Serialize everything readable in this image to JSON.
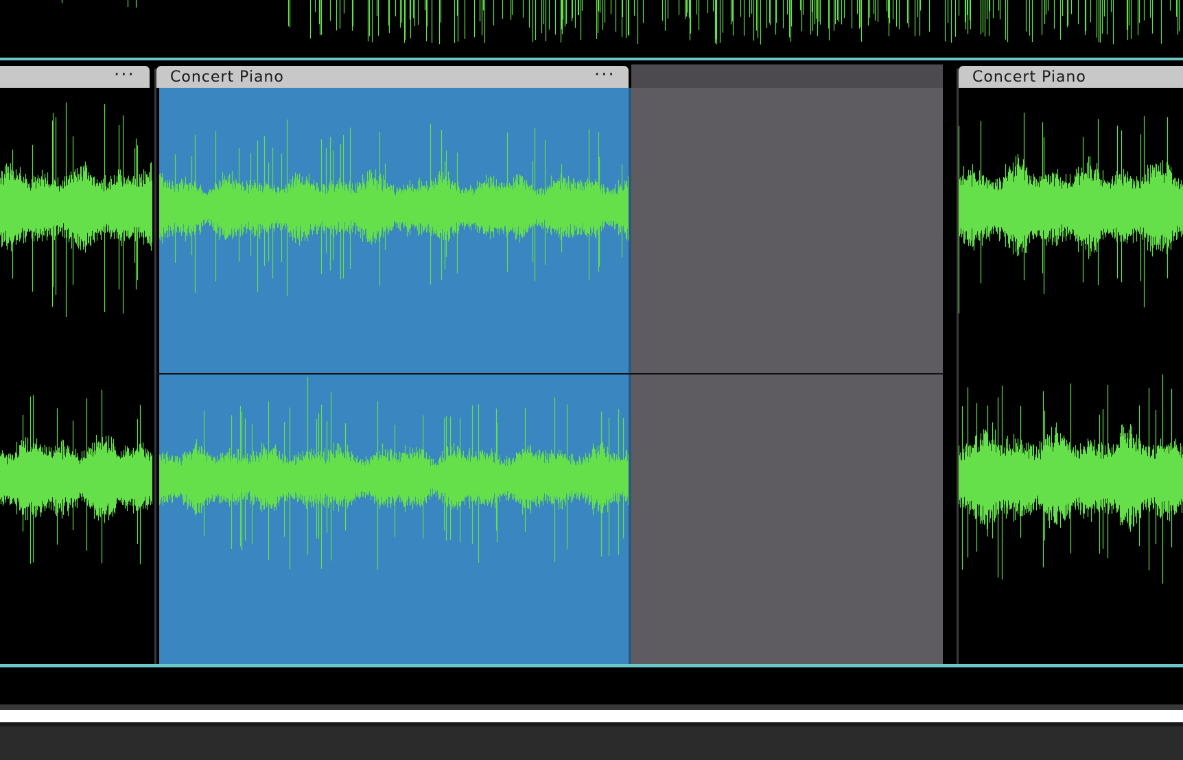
{
  "track": {
    "clips": [
      {
        "id": "clip-left",
        "name": "",
        "menu": "···"
      },
      {
        "id": "clip-selected",
        "name": "Concert  Piano",
        "menu": "···",
        "selected": true
      },
      {
        "id": "clip-right",
        "name": "Concert  Piano"
      }
    ]
  },
  "colors": {
    "background": "#000000",
    "waveform": "#66e04a",
    "selection": "#3a86c0",
    "empty_region": "#5e5c60",
    "track_border": "#6cc8c8",
    "clip_header": "#c8c8c8",
    "bottom_bar": "#2b2b2b"
  },
  "icons": {
    "clip_menu": "ellipsis-icon"
  }
}
